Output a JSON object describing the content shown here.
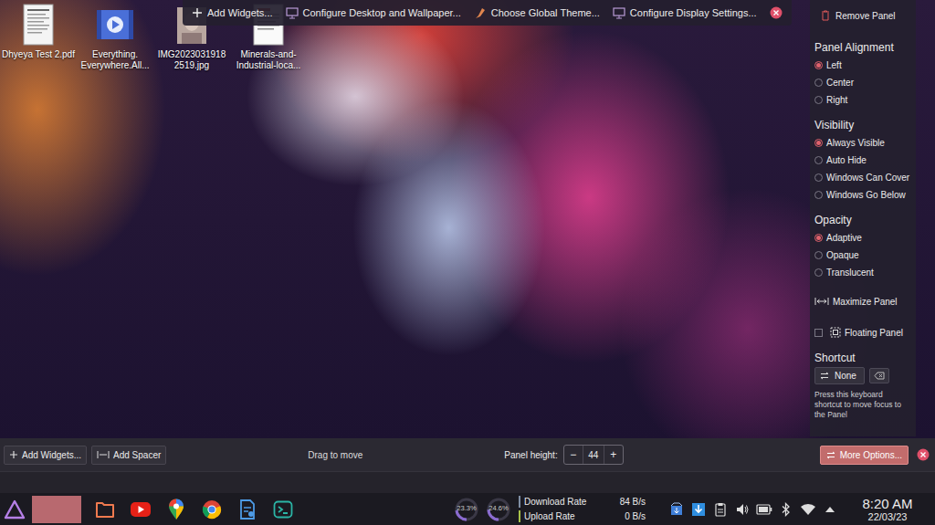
{
  "desktop": {
    "icons": [
      {
        "label": "Dhyeya Test 2.pdf",
        "kind": "pdf"
      },
      {
        "label": "Everything. Everywhere.All...",
        "kind": "video"
      },
      {
        "label": "IMG20230319182519.jpg",
        "kind": "image"
      },
      {
        "label": "Minerals-and-Industrial-loca...",
        "kind": "document"
      }
    ]
  },
  "desktop_toolbar": {
    "items": [
      {
        "label": "Add Widgets...",
        "kind": "add"
      },
      {
        "label": "Configure Desktop and Wallpaper...",
        "kind": "desktop"
      },
      {
        "label": "Choose Global Theme...",
        "kind": "theme"
      },
      {
        "label": "Configure Display Settings...",
        "kind": "display"
      }
    ]
  },
  "panel_options": {
    "remove": "Remove Panel",
    "groups": [
      {
        "title": "Panel Alignment",
        "options": [
          {
            "label": "Left",
            "selected": true
          },
          {
            "label": "Center",
            "selected": false
          },
          {
            "label": "Right",
            "selected": false
          }
        ]
      },
      {
        "title": "Visibility",
        "options": [
          {
            "label": "Always Visible",
            "selected": true
          },
          {
            "label": "Auto Hide",
            "selected": false
          },
          {
            "label": "Windows Can Cover",
            "selected": false
          },
          {
            "label": "Windows Go Below",
            "selected": false
          }
        ]
      },
      {
        "title": "Opacity",
        "options": [
          {
            "label": "Adaptive",
            "selected": true
          },
          {
            "label": "Opaque",
            "selected": false
          },
          {
            "label": "Translucent",
            "selected": false
          }
        ]
      }
    ],
    "maximize": "Maximize Panel",
    "floating": {
      "label": "Floating Panel",
      "checked": false
    },
    "shortcut": {
      "title": "Shortcut",
      "value": "None",
      "hint": "Press this keyboard shortcut to move focus to the Panel"
    }
  },
  "edit_bar": {
    "add_widgets": "Add Widgets...",
    "add_spacer": "Add Spacer",
    "drag_hint": "Drag to move",
    "height_label": "Panel height:",
    "height": "44",
    "decrease": "−",
    "increase": "+",
    "more_options": {
      "label": "More Options...",
      "selected": true
    }
  },
  "taskbar": {
    "items": [
      {
        "kind": "window",
        "selected": true
      },
      {
        "kind": "files",
        "selected": false
      },
      {
        "kind": "youtube",
        "selected": false
      },
      {
        "kind": "maps",
        "selected": false
      },
      {
        "kind": "chrome",
        "selected": false
      },
      {
        "kind": "app",
        "selected": false
      },
      {
        "kind": "terminal",
        "selected": false
      }
    ],
    "monitors": [
      {
        "reading": "23.3%",
        "level": 0.233
      },
      {
        "reading": "24.6%",
        "level": 0.246
      }
    ],
    "network": [
      {
        "label": "Download Rate",
        "value": "84 B/s",
        "color": "#7f8ea3"
      },
      {
        "label": "Upload Rate",
        "value": "0 B/s",
        "color": "#a8c24a"
      }
    ],
    "tray": [
      {
        "kind": "updates"
      },
      {
        "kind": "download"
      },
      {
        "kind": "clipboard"
      },
      {
        "kind": "volume"
      },
      {
        "kind": "battery"
      },
      {
        "kind": "bluetooth"
      },
      {
        "kind": "wifi"
      },
      {
        "kind": "expand"
      }
    ],
    "clock": {
      "time": "8:20 AM",
      "date": "22/03/23"
    }
  }
}
